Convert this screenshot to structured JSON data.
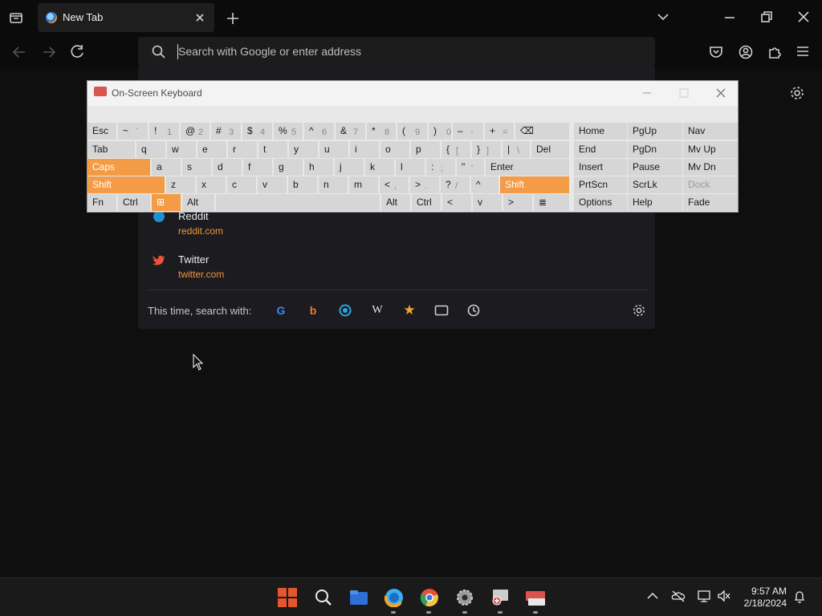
{
  "browser": {
    "tab_title": "New Tab",
    "search_placeholder": "Search with Google or enter address"
  },
  "dropdown": {
    "sites": [
      {
        "name": "Reddit",
        "url": "reddit.com"
      },
      {
        "name": "Twitter",
        "url": "twitter.com"
      }
    ],
    "search_with_label": "This time, search with:",
    "engines": [
      "google-icon",
      "bing-icon",
      "duckduckgo-icon",
      "wikipedia-icon",
      "bookmarks-star-icon",
      "tabs-icon",
      "history-icon"
    ]
  },
  "osk": {
    "title": "On-Screen Keyboard",
    "rows": [
      [
        {
          "m": "Esc"
        },
        {
          "m": "~",
          "s": "`"
        },
        {
          "m": "!",
          "s": "1"
        },
        {
          "m": "@",
          "s": "2"
        },
        {
          "m": "#",
          "s": "3"
        },
        {
          "m": "$",
          "s": "4"
        },
        {
          "m": "%",
          "s": "5"
        },
        {
          "m": "^",
          "s": "6"
        },
        {
          "m": "&",
          "s": "7"
        },
        {
          "m": "*",
          "s": "8"
        },
        {
          "m": "(",
          "s": "9"
        },
        {
          "m": ")",
          "s": "0"
        },
        {
          "m": "–",
          "s": "-"
        },
        {
          "m": "+",
          "s": "="
        },
        {
          "m": "⌫"
        }
      ],
      [
        {
          "m": "Tab"
        },
        {
          "m": "q"
        },
        {
          "m": "w"
        },
        {
          "m": "e"
        },
        {
          "m": "r"
        },
        {
          "m": "t"
        },
        {
          "m": "y"
        },
        {
          "m": "u"
        },
        {
          "m": "i"
        },
        {
          "m": "o"
        },
        {
          "m": "p"
        },
        {
          "m": "{",
          "s": "["
        },
        {
          "m": "}",
          "s": "]"
        },
        {
          "m": "|",
          "s": "\\"
        },
        {
          "m": "Del"
        }
      ],
      [
        {
          "m": "Caps"
        },
        {
          "m": "a"
        },
        {
          "m": "s"
        },
        {
          "m": "d"
        },
        {
          "m": "f"
        },
        {
          "m": "g"
        },
        {
          "m": "h"
        },
        {
          "m": "j"
        },
        {
          "m": "k"
        },
        {
          "m": "l"
        },
        {
          "m": ":",
          "s": ";"
        },
        {
          "m": "\"",
          "s": "'"
        },
        {
          "m": "Enter"
        }
      ],
      [
        {
          "m": "Shift"
        },
        {
          "m": "z"
        },
        {
          "m": "x"
        },
        {
          "m": "c"
        },
        {
          "m": "v"
        },
        {
          "m": "b"
        },
        {
          "m": "n"
        },
        {
          "m": "m"
        },
        {
          "m": "<",
          "s": ","
        },
        {
          "m": ">",
          "s": "."
        },
        {
          "m": "?",
          "s": "/"
        },
        {
          "m": "^"
        },
        {
          "m": "Shift"
        }
      ],
      [
        {
          "m": "Fn"
        },
        {
          "m": "Ctrl"
        },
        {
          "m": "⊞"
        },
        {
          "m": "Alt"
        },
        {
          "m": ""
        },
        {
          "m": "Alt"
        },
        {
          "m": "Ctrl"
        },
        {
          "m": "<"
        },
        {
          "m": "v"
        },
        {
          "m": ">"
        },
        {
          "m": "≣"
        }
      ]
    ],
    "side": [
      [
        "Home",
        "PgUp",
        "Nav"
      ],
      [
        "End",
        "PgDn",
        "Mv Up"
      ],
      [
        "Insert",
        "Pause",
        "Mv Dn"
      ],
      [
        "PrtScn",
        "ScrLk",
        "Dock"
      ],
      [
        "Options",
        "Help",
        "Fade"
      ]
    ]
  },
  "taskbar": {
    "time": "9:57 AM",
    "date": "2/18/2024",
    "apps": [
      "start-icon",
      "search-icon",
      "file-explorer-icon",
      "firefox-icon",
      "chrome-icon",
      "settings-icon",
      "magnifier-icon",
      "on-screen-keyboard-icon"
    ]
  }
}
